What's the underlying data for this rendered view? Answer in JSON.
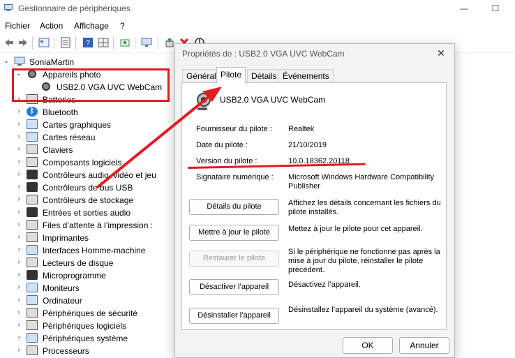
{
  "window": {
    "title": "Gestionnaire de périphériques",
    "minimize": "—",
    "maximize": "☐"
  },
  "menu": [
    "Fichier",
    "Action",
    "Affichage",
    "?"
  ],
  "tree": {
    "root": "SoniaMartin",
    "items": [
      {
        "label": "Appareils photo",
        "expanded": true,
        "icon": "camera-icon"
      },
      {
        "label": "USB2.0 VGA UVC WebCam",
        "child": true,
        "icon": "camera-icon"
      },
      {
        "label": "Batteries",
        "icon": "battery-icon"
      },
      {
        "label": "Bluetooth",
        "icon": "bluetooth-icon"
      },
      {
        "label": "Cartes graphiques",
        "icon": "display-adapter-icon"
      },
      {
        "label": "Cartes réseau",
        "icon": "network-adapter-icon"
      },
      {
        "label": "Claviers",
        "icon": "keyboard-icon"
      },
      {
        "label": "Composants logiciels",
        "icon": "software-component-icon"
      },
      {
        "label": "Contrôleurs audio, vidéo et jeu",
        "icon": "audio-icon"
      },
      {
        "label": "Contrôleurs de bus USB",
        "icon": "usb-icon"
      },
      {
        "label": "Contrôleurs de stockage",
        "icon": "storage-controller-icon"
      },
      {
        "label": "Entrées et sorties audio",
        "icon": "speaker-icon"
      },
      {
        "label": "Files d’attente à l’impression :",
        "icon": "print-queue-icon"
      },
      {
        "label": "Imprimantes",
        "icon": "printer-icon"
      },
      {
        "label": "Interfaces Homme-machine",
        "icon": "hid-icon"
      },
      {
        "label": "Lecteurs de disque",
        "icon": "disk-drive-icon"
      },
      {
        "label": "Microprogramme",
        "icon": "firmware-icon"
      },
      {
        "label": "Moniteurs",
        "icon": "monitor-icon"
      },
      {
        "label": "Ordinateur",
        "icon": "computer-icon"
      },
      {
        "label": "Périphériques de sécurité",
        "icon": "security-device-icon"
      },
      {
        "label": "Périphériques logiciels",
        "icon": "software-device-icon"
      },
      {
        "label": "Périphériques système",
        "icon": "system-device-icon"
      },
      {
        "label": "Processeurs",
        "icon": "processor-icon"
      }
    ]
  },
  "dialog": {
    "title": "Propriétés de : USB2.0 VGA UVC WebCam",
    "close": "✕",
    "tabs": [
      "Général",
      "Pilote",
      "Détails",
      "Événements"
    ],
    "active_tab": "Pilote",
    "device_name": "USB2.0 VGA UVC WebCam",
    "properties": [
      {
        "label": "Fournisseur du pilote :",
        "value": "Realtek"
      },
      {
        "label": "Date du pilote :",
        "value": "21/10/2019"
      },
      {
        "label": "Version du pilote :",
        "value": "10.0.18362.20118"
      },
      {
        "label": "Signataire numérique :",
        "value": "Microsoft Windows Hardware Compatibility Publisher"
      }
    ],
    "actions": [
      {
        "button": "Détails du pilote",
        "desc": "Affichez les détails concernant les fichiers du pilote installés.",
        "disabled": false
      },
      {
        "button": "Mettre à jour le pilote",
        "desc": "Mettez à jour le pilote pour cet appareil.",
        "disabled": false
      },
      {
        "button": "Restaurer le pilote",
        "desc": "Si le périphérique ne fonctionne pas après la mise à jour du pilote, réinstaller le pilote précédent.",
        "disabled": true
      },
      {
        "button": "Désactiver l’appareil",
        "desc": "Désactivez l’appareil.",
        "disabled": false
      },
      {
        "button": "Désinstaller l’appareil",
        "desc": "Désinstallez l’appareil du système (avancé).",
        "disabled": false
      }
    ],
    "ok": "OK",
    "cancel": "Annuler"
  },
  "colors": {
    "annotation_red": "#e31b23",
    "accent_blue": "#1e7be0"
  }
}
